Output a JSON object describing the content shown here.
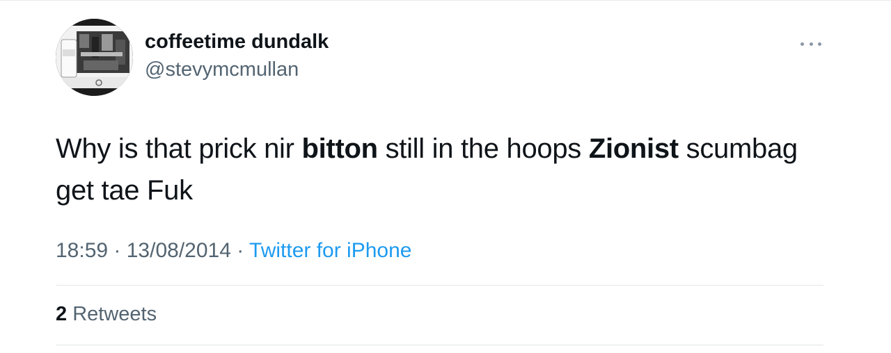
{
  "tweet": {
    "author": {
      "display_name": "coffeetime dundalk",
      "handle": "@stevymcmullan",
      "avatar_icon": "avatar-photo-icon"
    },
    "more_icon": "ellipsis-icon",
    "text": {
      "seg1": "Why is that prick nir ",
      "bold1": "bitton",
      "seg2": " still in the hoops ",
      "bold2": "Zionist",
      "seg3": " scumbag get tae Fuk"
    },
    "meta": {
      "time": "18:59",
      "sep1": " · ",
      "date": "13/08/2014",
      "sep2": " · ",
      "source": "Twitter for iPhone"
    },
    "stats": {
      "retweet_count": "2",
      "retweet_label": "Retweets"
    }
  },
  "colors": {
    "text_primary": "#0f1419",
    "text_secondary": "#536471",
    "link": "#1d9bf0",
    "divider": "#e1e4e6"
  }
}
